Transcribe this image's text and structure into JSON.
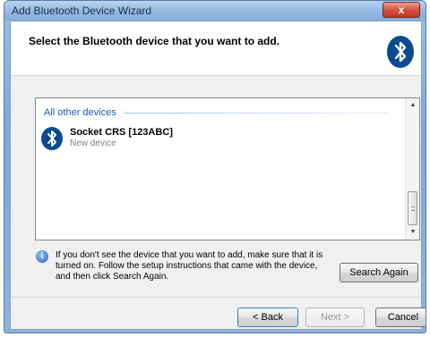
{
  "window": {
    "title": "Add Bluetooth Device Wizard",
    "close_label": "x"
  },
  "header": {
    "title": "Select the Bluetooth device that you want to add.",
    "icon": "bluetooth-icon"
  },
  "device_list": {
    "group_label": "All other devices",
    "items": [
      {
        "name": "Socket CRS [123ABC]",
        "status": "New device",
        "icon": "bluetooth-icon"
      }
    ],
    "scrollbar": {
      "up": "▲",
      "down": "▼"
    }
  },
  "info": {
    "icon": "info-icon",
    "glyph": "i",
    "text": "If you don't see the device that you want to add, make sure that it is turned on. Follow the setup instructions that came with the device, and then click Search Again."
  },
  "buttons": {
    "search_again": "Search Again",
    "back": "< Back",
    "next": "Next >",
    "cancel": "Cancel"
  },
  "colors": {
    "bluetooth_blue": "#0a4a8f",
    "group_header": "#1e5bb3",
    "title_bar": "#92b8e2"
  }
}
